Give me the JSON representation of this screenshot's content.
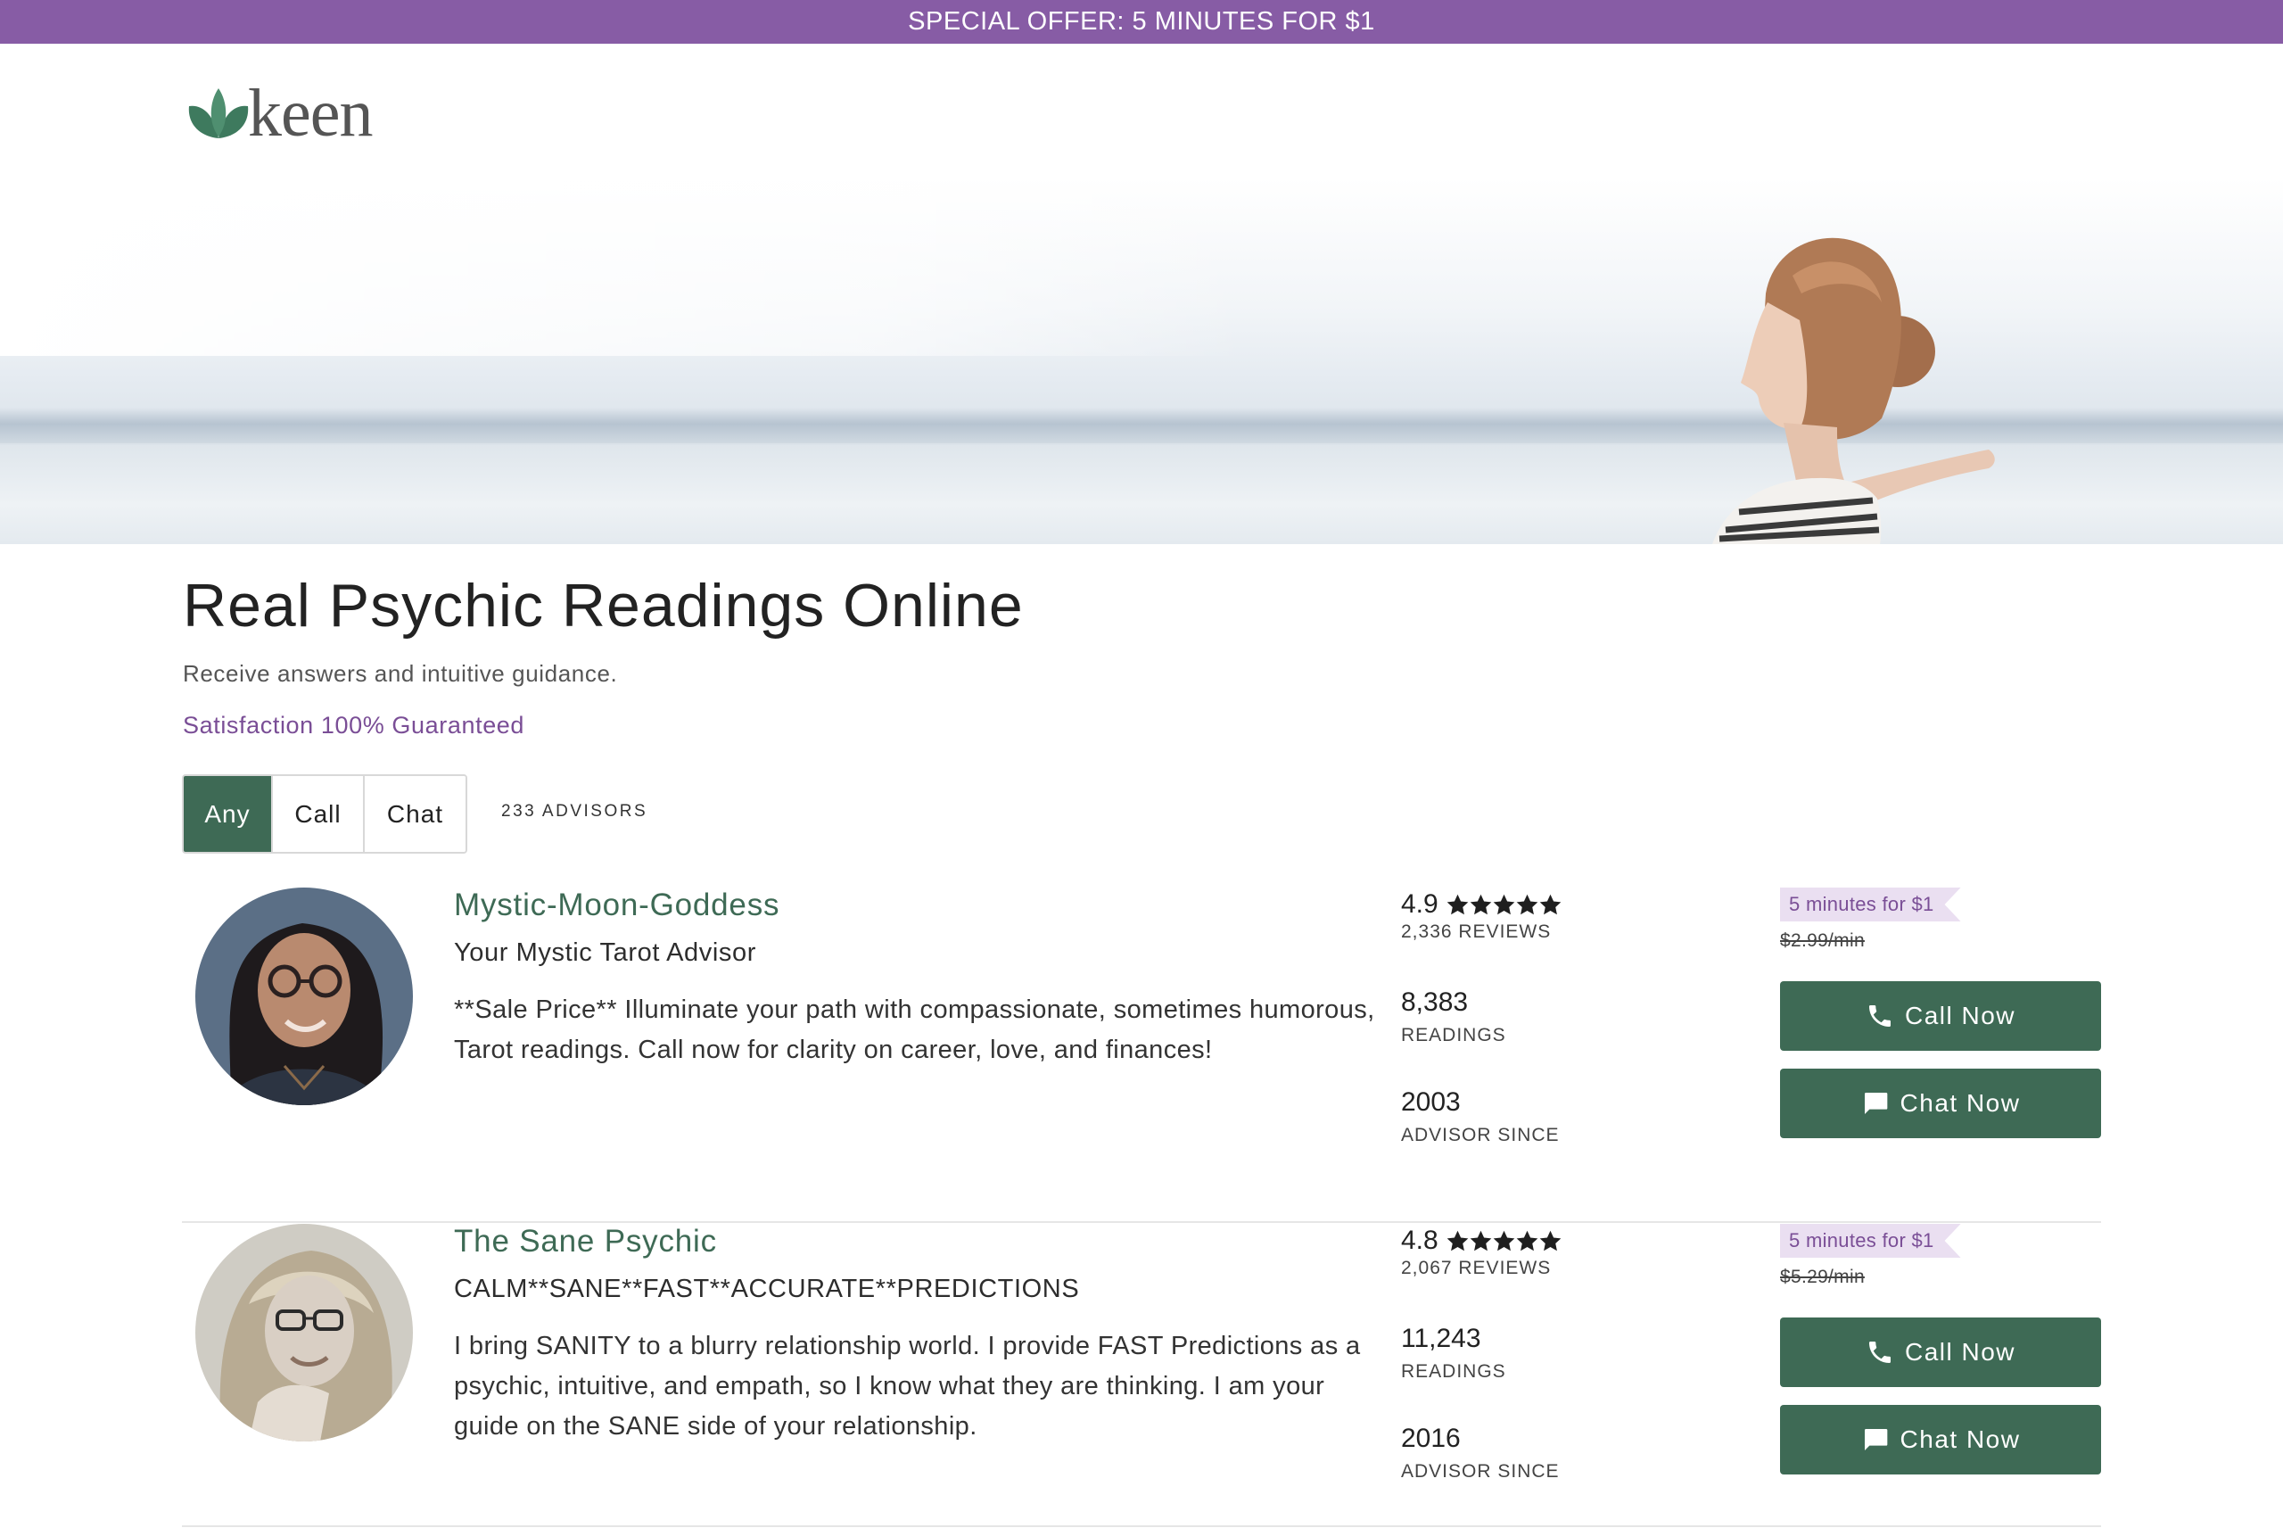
{
  "promo": {
    "text": "SPECIAL OFFER: 5 MINUTES FOR $1"
  },
  "logo": {
    "text": "keen",
    "icon": "leaf-icon"
  },
  "hero": {
    "image": "woman-at-beach-arms-open"
  },
  "page": {
    "title": "Real Psychic Readings Online",
    "subtitle": "Receive answers and intuitive guidance.",
    "guarantee": "Satisfaction 100% Guaranteed"
  },
  "filters": {
    "options": [
      "Any",
      "Call",
      "Chat"
    ],
    "selected": "Any",
    "advisor_count": "233 ADVISORS"
  },
  "colors": {
    "promo_bar": "#875ca5",
    "brand_green": "#3e6a55",
    "accent_purple": "#7a4e96",
    "offer_tag_bg": "#eadff1"
  },
  "advisors": [
    {
      "name": "Mystic-Moon-Goddess",
      "tagline": "Your Mystic Tarot Advisor",
      "description": "**Sale Price** Illuminate your path with compassionate, sometimes humorous, Tarot readings. Call now for clarity on career, love, and finances!",
      "rating": "4.9",
      "stars": 5,
      "reviews": "2,336 REVIEWS",
      "readings": "8,383",
      "readings_label": "READINGS",
      "advisor_since": "2003",
      "advisor_since_label": "ADVISOR SINCE",
      "offer": "5 minutes for $1",
      "old_price": "$2.99/min",
      "call_label": "Call Now",
      "chat_label": "Chat Now"
    },
    {
      "name": "The Sane Psychic",
      "tagline": "CALM**SANE**FAST**ACCURATE**PREDICTIONS",
      "description": "I bring SANITY to a blurry relationship world. I provide FAST Predictions as a psychic, intuitive, and empath, so I know what they are thinking. I am your guide on the SANE side of your relationship.",
      "rating": "4.8",
      "stars": 5,
      "reviews": "2,067 REVIEWS",
      "readings": "11,243",
      "readings_label": "READINGS",
      "advisor_since": "2016",
      "advisor_since_label": "ADVISOR SINCE",
      "offer": "5 minutes for $1",
      "old_price": "$5.29/min",
      "call_label": "Call Now",
      "chat_label": "Chat Now"
    }
  ]
}
